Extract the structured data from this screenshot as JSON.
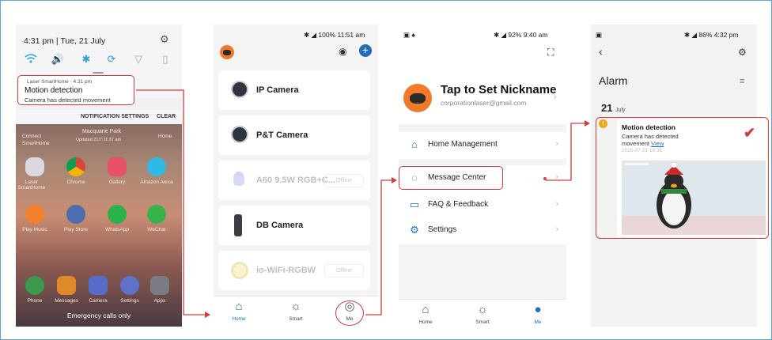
{
  "colors": {
    "accent_red": "#d63a3a",
    "blue": "#1f6fb8",
    "orange": "#f07a2a"
  },
  "phone1": {
    "time": "4:31 pm",
    "date": "Tue, 21 July",
    "notification": {
      "app": "Laser SmartHome",
      "time": "4:31 pm",
      "title": "Motion detection",
      "body": "Camera has detected movement"
    },
    "notif_settings": "NOTIFICATION SETTINGS",
    "clear": "CLEAR",
    "home_texts": {
      "connect": "Connect",
      "smarthome": "SmartHome",
      "location": "Macquarie Park",
      "updated": "Updated 21/7 11:37 am",
      "home": "Home"
    },
    "apps_row1": [
      "Laser SmartHome",
      "Chrome",
      "Gallery",
      "Amazon Alexa"
    ],
    "apps_row2": [
      "Play Music",
      "Play Store",
      "WhatsApp",
      "WeChat"
    ],
    "apps_row3": [
      "Phone",
      "Messages",
      "Camera",
      "Settings",
      "Apps"
    ],
    "emergency": "Emergency calls only"
  },
  "phone2": {
    "status": "100% 11:51 am",
    "devices": [
      {
        "label": "IP Camera",
        "offline": false
      },
      {
        "label": "P&T Camera",
        "offline": false
      },
      {
        "label": "A60 9.5W RGB+C...",
        "offline": true
      },
      {
        "label": "DB Camera",
        "offline": false
      },
      {
        "label": "io-WiFi-RGBW",
        "offline": true
      }
    ],
    "offline_label": "Offline",
    "nav": [
      "Home",
      "Smart",
      "Me"
    ]
  },
  "phone3": {
    "status": "92% 9:40 am",
    "nickname": "Tap to Set Nickname",
    "email": "corporationlaser@gmail.com",
    "menu": [
      "Home Management",
      "Message Center",
      "FAQ & Feedback",
      "Settings"
    ],
    "nav": [
      "Home",
      "Smart",
      "Me"
    ]
  },
  "phone4": {
    "status": "86% 4:32 pm",
    "title": "Alarm",
    "day": "21",
    "month": "July",
    "alert": {
      "title": "Motion detection",
      "body": "Camera has detected movement",
      "link": "View",
      "date": "2020-07-21 16:31"
    }
  }
}
